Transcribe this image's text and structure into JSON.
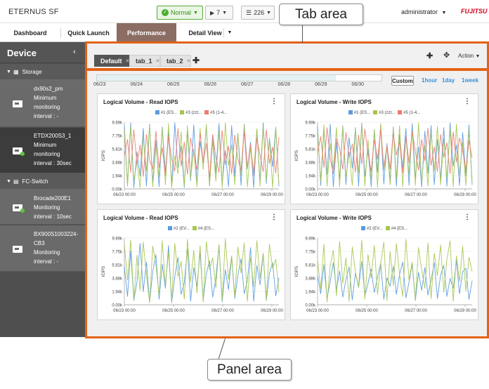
{
  "header": {
    "brand": "ETERNUS SF",
    "status_label": "Normal",
    "jobs_count": "7",
    "events_count": "226",
    "user": "administrator",
    "logo": "FUJITSU"
  },
  "nav": {
    "items": [
      "Dashboard",
      "Quick Launch",
      "Performance",
      "Detail View"
    ]
  },
  "sidebar": {
    "title": "Device",
    "groups": [
      {
        "name": "Storage",
        "devices": [
          {
            "lines": [
              "dx90s2_pm",
              "Minimum",
              "monitoring",
              "interval : -"
            ]
          },
          {
            "lines": [
              "ETDX200S3_1",
              "Minimum",
              "monitoring",
              "interval : 30sec"
            ]
          }
        ]
      },
      {
        "name": "FC-Switch",
        "devices": [
          {
            "lines": [
              "Brocade200E1",
              "Monitoring",
              "interval : 10sec"
            ]
          },
          {
            "lines": [
              "BX900S1003224-",
              "CB3",
              "Monitoring",
              "interval : -"
            ]
          }
        ]
      }
    ]
  },
  "tabs": {
    "items": [
      "Default",
      "tab_1",
      "tab_2"
    ],
    "action_label": "Action"
  },
  "timeline": {
    "dates": [
      "06/23",
      "06/24",
      "06/25",
      "06/26",
      "06/27",
      "06/28",
      "06/29",
      "06/30"
    ],
    "range_custom": "Custom",
    "range_options": [
      "1hour",
      "1day",
      "1week"
    ]
  },
  "colors": {
    "blue": "#5b9be0",
    "green": "#a6c64e",
    "red": "#ef7a72",
    "accent": "#e36216",
    "link": "#3a8fd6"
  },
  "annotations": {
    "tab_area": "Tab area",
    "panel_area": "Panel area"
  },
  "chart_data": [
    {
      "type": "line",
      "title": "Logical Volume - Read IOPS",
      "ylabel": "IOPS",
      "ylim": [
        0,
        9.69
      ],
      "yticks": [
        "0.00k",
        "1.94k",
        "3.88k",
        "5.81k",
        "7.75k",
        "9.69k"
      ],
      "xticks": [
        "06/23 00:00",
        "06/25 00:00",
        "06/27 00:00",
        "06/29 00:00"
      ],
      "series": [
        {
          "name": "#1 (ES...",
          "color": "#5b9be0",
          "values": [
            9.2,
            0.6,
            9.6,
            0.2,
            5.4,
            1.9,
            8.8,
            0.4,
            9.4,
            0.9,
            7.1,
            0.3,
            9.0,
            2.4,
            8.2,
            0.5,
            9.6,
            3.1,
            6.2,
            0.2,
            8.4,
            1.2,
            9.3,
            0.7,
            6.9,
            3.8,
            9.1,
            0.4,
            7.8,
            2.2,
            9.5,
            0.6,
            5.6,
            0.3,
            9.2,
            1.8,
            8.0,
            0.5,
            9.4,
            2.9,
            6.8,
            0.2,
            8.7,
            1.1,
            9.6,
            0.8,
            7.4,
            3.2,
            9.0,
            0.4
          ]
        },
        {
          "name": "#3 (zzt...",
          "color": "#a6c64e",
          "values": [
            8.6,
            0.4,
            9.1,
            1.2,
            3.9,
            0.2,
            7.6,
            2.6,
            9.3,
            0.3,
            6.2,
            1.7,
            8.9,
            0.6,
            9.5,
            0.2,
            4.8,
            2.2,
            8.3,
            0.4,
            9.2,
            1.5,
            5.7,
            0.3,
            8.8,
            2.8,
            9.4,
            0.5,
            7.0,
            1.1,
            8.5,
            0.2,
            9.6,
            3.4,
            6.4,
            0.6,
            8.1,
            1.9,
            9.3,
            0.3,
            5.9,
            2.5,
            8.7,
            0.4,
            9.1,
            1.3,
            7.3,
            0.2,
            8.9,
            0.7
          ]
        },
        {
          "name": "#5 (1-4...",
          "color": "#ef7a72",
          "values": [
            4.8,
            7.2,
            2.4,
            8.6,
            3.6,
            6.4,
            1.8,
            7.9,
            4.2,
            2.9,
            8.4,
            3.1,
            6.0,
            1.9,
            7.6,
            4.4,
            2.6,
            8.8,
            3.3,
            6.8,
            2.1,
            7.4,
            5.0,
            2.8,
            8.1,
            3.9,
            6.6,
            1.6,
            7.9,
            4.6,
            2.4,
            8.5,
            3.5,
            6.2,
            2.2,
            7.8,
            4.3,
            2.7,
            8.3,
            3.2,
            6.5,
            1.9,
            7.3,
            4.9,
            2.5,
            8.6,
            3.7,
            6.1,
            2.3,
            7.5
          ]
        }
      ]
    },
    {
      "type": "line",
      "title": "Logical Volume - Write IOPS",
      "ylabel": "IOPS",
      "ylim": [
        0,
        9.69
      ],
      "yticks": [
        "0.00k",
        "1.94k",
        "3.88k",
        "5.81k",
        "7.75k",
        "9.69k"
      ],
      "xticks": [
        "06/23 00:00",
        "06/25 00:00",
        "06/27 00:00",
        "06/29 00:00"
      ],
      "series": [
        {
          "name": "#1 (ES...",
          "color": "#5b9be0",
          "values": [
            9.1,
            0.5,
            8.7,
            2.1,
            9.4,
            0.3,
            6.8,
            1.4,
            9.2,
            0.6,
            7.5,
            3.0,
            8.9,
            0.4,
            9.6,
            1.8,
            5.8,
            0.3,
            8.6,
            2.4,
            9.3,
            0.7,
            6.6,
            1.2,
            9.0,
            0.4,
            7.9,
            2.9,
            8.8,
            0.5,
            9.5,
            1.6,
            6.1,
            0.3,
            8.4,
            2.2,
            9.2,
            0.6,
            7.2,
            1.3,
            8.9,
            0.4,
            9.6,
            3.3,
            6.4,
            0.5,
            8.2,
            1.9,
            9.3,
            0.6
          ]
        },
        {
          "name": "#3 (zzt...",
          "color": "#a6c64e",
          "values": [
            8.4,
            1.1,
            9.3,
            0.4,
            6.6,
            2.8,
            8.9,
            0.3,
            9.1,
            1.6,
            5.3,
            0.5,
            8.7,
            2.3,
            9.4,
            0.4,
            7.1,
            1.3,
            8.6,
            0.2,
            9.5,
            2.7,
            6.0,
            0.6,
            8.8,
            1.4,
            9.2,
            0.3,
            7.6,
            2.1,
            8.5,
            0.5,
            9.6,
            1.0,
            6.3,
            0.4,
            8.3,
            2.6,
            9.1,
            0.6,
            7.3,
            1.5,
            8.8,
            0.3,
            9.4,
            2.0,
            6.7,
            0.5,
            8.6,
            1.2
          ]
        },
        {
          "name": "#5 (1-4...",
          "color": "#ef7a72",
          "values": [
            5.2,
            7.6,
            3.1,
            8.9,
            4.4,
            2.2,
            7.3,
            5.9,
            2.8,
            8.2,
            4.7,
            6.5,
            2.4,
            7.8,
            3.6,
            8.7,
            5.1,
            2.6,
            7.1,
            4.3,
            8.5,
            3.2,
            6.3,
            2.9,
            8.0,
            4.9,
            6.9,
            2.3,
            7.7,
            3.8,
            8.4,
            5.4,
            2.7,
            7.2,
            4.1,
            8.8,
            3.4,
            6.1,
            2.5,
            7.9,
            4.6,
            6.7,
            2.2,
            8.3,
            3.9,
            7.4,
            5.6,
            2.8,
            7.0,
            4.5
          ]
        }
      ]
    },
    {
      "type": "line",
      "title": "Logical Volume - Read IOPS",
      "ylabel": "IOPS",
      "ylim": [
        0,
        9.69
      ],
      "yticks": [
        "0.00k",
        "1.94k",
        "3.88k",
        "5.81k",
        "7.75k",
        "9.69k"
      ],
      "xticks": [
        "06/23 00:00",
        "06/25 00:00",
        "06/27 00:00",
        "06/29 00:00"
      ],
      "series": [
        {
          "name": "#2 (EV...",
          "color": "#5b9be0",
          "values": [
            5.6,
            1.2,
            7.8,
            0.6,
            3.4,
            8.9,
            1.9,
            6.2,
            0.4,
            4.8,
            7.3,
            0.8,
            5.9,
            2.4,
            8.6,
            0.3,
            4.1,
            6.9,
            1.5,
            3.2,
            8.1,
            0.5,
            5.4,
            2.7,
            7.6,
            0.7,
            4.5,
            6.4,
            1.1,
            3.8,
            8.7,
            0.4,
            5.1,
            2.2,
            7.0,
            0.9,
            4.3,
            6.7,
            1.6,
            3.5,
            8.3,
            0.5,
            5.7,
            2.9,
            7.4,
            0.6,
            4.6,
            6.1,
            1.3,
            3.9
          ]
        },
        {
          "name": "#4 (ES...",
          "color": "#a6c64e",
          "values": [
            8.8,
            3.6,
            9.4,
            0.6,
            7.2,
            2.1,
            9.1,
            4.4,
            0.3,
            8.5,
            5.8,
            1.4,
            9.3,
            2.9,
            7.7,
            0.5,
            8.9,
            4.1,
            6.3,
            0.8,
            9.5,
            3.3,
            7.9,
            1.7,
            8.6,
            0.4,
            9.2,
            5.1,
            6.8,
            2.4,
            8.7,
            0.6,
            9.6,
            3.7,
            7.1,
            1.2,
            8.4,
            4.6,
            9.0,
            0.5,
            6.9,
            2.6,
            9.3,
            3.9,
            7.5,
            0.7,
            8.8,
            5.3,
            6.6,
            1.8
          ]
        }
      ]
    },
    {
      "type": "line",
      "title": "Logical Volume - Write IOPS",
      "ylabel": "IOPS",
      "ylim": [
        0,
        9.69
      ],
      "yticks": [
        "0.00k",
        "1.94k",
        "3.88k",
        "5.81k",
        "7.75k",
        "9.69k"
      ],
      "xticks": [
        "06/23 00:00",
        "06/25 00:00",
        "06/27 00:00",
        "06/29 00:00"
      ],
      "series": [
        {
          "name": "#2 (EV...",
          "color": "#5b9be0",
          "values": [
            4.2,
            1.6,
            5.8,
            0.9,
            3.4,
            6.1,
            2.2,
            4.9,
            1.1,
            3.7,
            5.5,
            0.7,
            4.6,
            2.5,
            6.3,
            1.3,
            3.1,
            5.2,
            1.8,
            4.0,
            6.0,
            0.8,
            3.9,
            2.7,
            5.6,
            1.5,
            4.4,
            6.2,
            1.0,
            3.3,
            5.9,
            0.6,
            4.7,
            2.1,
            5.4,
            1.4,
            3.6,
            6.1,
            0.9,
            4.3,
            5.7,
            1.2,
            3.8,
            2.4,
            6.4,
            1.6,
            4.8,
            5.3,
            0.8,
            3.5
          ]
        },
        {
          "name": "#4 (ES...",
          "color": "#a6c64e",
          "values": [
            6.4,
            2.3,
            8.8,
            0.4,
            5.6,
            7.9,
            1.3,
            9.2,
            3.1,
            6.8,
            0.5,
            8.4,
            4.7,
            2.6,
            9.4,
            0.8,
            7.3,
            3.9,
            8.6,
            1.5,
            5.9,
            9.1,
            0.6,
            7.7,
            2.8,
            8.9,
            4.4,
            1.2,
            9.5,
            3.6,
            6.2,
            0.7,
            8.3,
            5.1,
            2.4,
            9.0,
            0.9,
            7.5,
            4.2,
            8.7,
            1.8,
            6.6,
            9.3,
            0.5,
            7.1,
            3.4,
            8.5,
            2.0,
            6.9,
            4.8
          ]
        }
      ]
    }
  ]
}
